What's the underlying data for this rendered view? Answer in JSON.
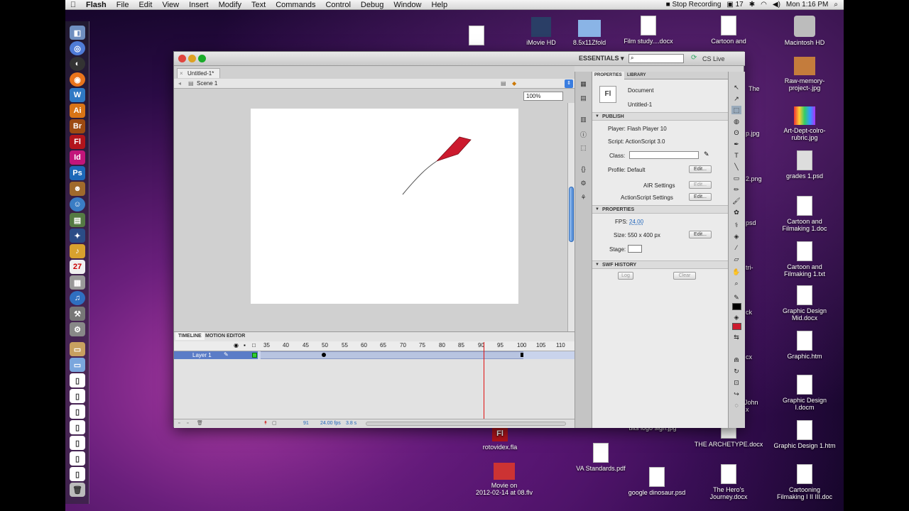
{
  "menubar": {
    "app": "Flash",
    "items": [
      "File",
      "Edit",
      "View",
      "Insert",
      "Modify",
      "Text",
      "Commands",
      "Control",
      "Debug",
      "Window",
      "Help"
    ],
    "stop_recording": "Stop Recording",
    "num": "17",
    "clock": "Mon 1:16 PM"
  },
  "window": {
    "doc_tab": "Untitled-1*",
    "scene": "Scene 1",
    "zoom": "100%",
    "essentials": "ESSENTIALS ▾",
    "cs_live": "CS Live"
  },
  "timeline": {
    "tab_timeline": "TIMELINE",
    "tab_motion": "MOTION EDITOR",
    "ticks": [
      "35",
      "40",
      "45",
      "50",
      "55",
      "60",
      "65",
      "70",
      "75",
      "80",
      "85",
      "90",
      "95",
      "100",
      "105",
      "110"
    ],
    "layer": "Layer 1",
    "status_frame": "91",
    "status_fps": "24.00 fps",
    "status_time": "3.8 s"
  },
  "properties": {
    "tab_props": "PROPERTIES",
    "tab_library": "LIBRARY",
    "doc_type": "Document",
    "doc_name": "Untitled-1",
    "sec_publish": "PUBLISH",
    "player": "Player: Flash Player 10",
    "script": "Script: ActionScript 3.0",
    "class_label": "Class:",
    "profile": "Profile: Default",
    "air": "AIR Settings",
    "as_settings": "ActionScript Settings",
    "sec_properties": "PROPERTIES",
    "fps_label": "FPS:",
    "fps": "24.00",
    "size": "Size: 550 x 400 px",
    "stage_label": "Stage:",
    "sec_swf": "SWF HISTORY",
    "log": "Log",
    "clear": "Clear",
    "edit": "Edit..."
  },
  "desktop": {
    "imovie": "iMovie HD",
    "fold": "8.5x11Zfold",
    "film": "Film study....docx",
    "cartoon_top": "Cartoon and",
    "mac_hd": "Macintosh HD",
    "raw": "Raw-memory-",
    "raw2": "project-.jpg",
    "art": "Art-Dept-colro-",
    "art2": "rubric.jpg",
    "grades": "grades 1.psd",
    "cf_doc": "Cartoon and",
    "cf_doc2": "Filmaking 1.doc",
    "cf_txt": "Cartoon and",
    "cf_txt2": "Filmaking 1.txt",
    "gdm": "Graphic Design",
    "gdm2": "Mid.docx",
    "ghtm": "Graphic.htm",
    "gdl": "Graphic Design",
    "gdl2": "I.docm",
    "gd1": "Graphic Design 1.htm",
    "cart_iii": "Cartooning",
    "cart_iii2": "Filmaking I II III.doc",
    "roto": "rotovidex.fla",
    "va": "VA Standards.pdf",
    "archetype": "THE ARCHETYPE.docx",
    "movie": "Movie on",
    "movie2": "2012-02-14 at 08.flv",
    "dino": "google dinosaur.psd",
    "hero": "The Hero's",
    "hero2": "Journey.docx",
    "bits": "bits logo sign.jpg",
    "the": "The",
    "ppg": "p.jpg",
    "png2": "2.png",
    "psd": "psd",
    "tri": "tri-",
    "ck": "ck",
    "cx": "cx",
    "john": "John",
    "x": "x"
  }
}
